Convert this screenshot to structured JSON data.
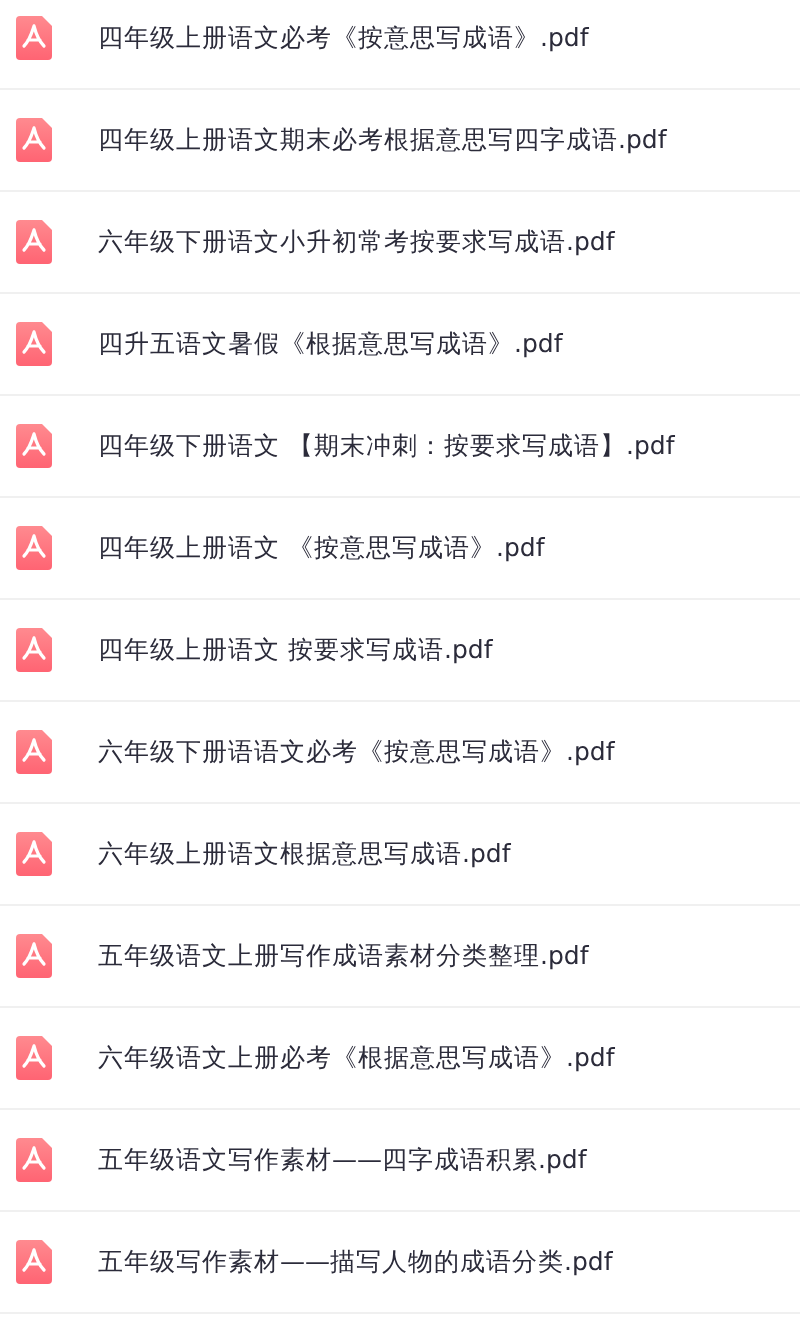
{
  "files": [
    {
      "name": "四年级上册语文必考《按意思写成语》.pdf"
    },
    {
      "name": "四年级上册语文期末必考根据意思写四字成语.pdf"
    },
    {
      "name": "六年级下册语文小升初常考按要求写成语.pdf"
    },
    {
      "name": "四升五语文暑假《根据意思写成语》.pdf"
    },
    {
      "name": "四年级下册语文 【期末冲刺：按要求写成语】.pdf"
    },
    {
      "name": "四年级上册语文 《按意思写成语》.pdf"
    },
    {
      "name": "四年级上册语文 按要求写成语.pdf"
    },
    {
      "name": "六年级下册语语文必考《按意思写成语》.pdf"
    },
    {
      "name": "六年级上册语文根据意思写成语.pdf"
    },
    {
      "name": "五年级语文上册写作成语素材分类整理.pdf"
    },
    {
      "name": "六年级语文上册必考《根据意思写成语》.pdf"
    },
    {
      "name": "五年级语文写作素材——四字成语积累.pdf"
    },
    {
      "name": "五年级写作素材——描写人物的成语分类.pdf"
    }
  ]
}
